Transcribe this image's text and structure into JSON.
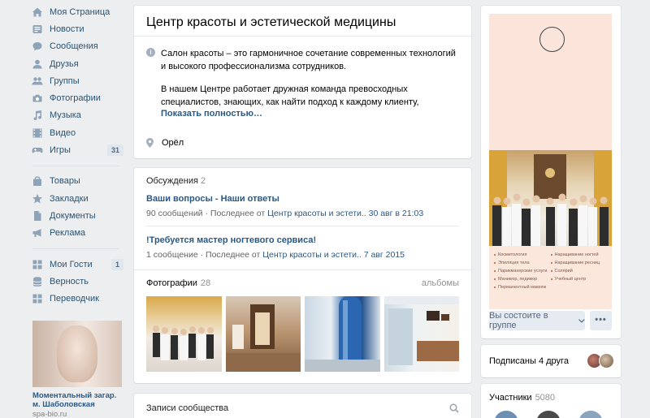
{
  "left_menu": {
    "items": [
      {
        "label": "Моя Страница",
        "icon": "home-icon"
      },
      {
        "label": "Новости",
        "icon": "news-icon"
      },
      {
        "label": "Сообщения",
        "icon": "messages-icon"
      },
      {
        "label": "Друзья",
        "icon": "friends-icon"
      },
      {
        "label": "Группы",
        "icon": "groups-icon"
      },
      {
        "label": "Фотографии",
        "icon": "camera-icon"
      },
      {
        "label": "Музыка",
        "icon": "music-icon"
      },
      {
        "label": "Видео",
        "icon": "video-icon"
      },
      {
        "label": "Игры",
        "icon": "gamepad-icon",
        "counter": "31"
      }
    ],
    "items2": [
      {
        "label": "Товары",
        "icon": "bag-icon"
      },
      {
        "label": "Закладки",
        "icon": "star-icon"
      },
      {
        "label": "Документы",
        "icon": "document-icon"
      },
      {
        "label": "Реклама",
        "icon": "megaphone-icon"
      }
    ],
    "items3": [
      {
        "label": "Мои Гости",
        "icon": "apps-icon",
        "counter": "1"
      },
      {
        "label": "Верность",
        "icon": "database-icon"
      },
      {
        "label": "Переводчик",
        "icon": "apps-icon"
      }
    ]
  },
  "ad": {
    "title": "Моментальный загар. м. Шаболовская",
    "domain": "spa-bio.ru"
  },
  "group": {
    "title": "Центр красоты и эстетической медицины",
    "description_line1": "Салон красоты             – это гармоничное сочетание современных технологий и высокого профессионализма сотрудников.",
    "description_line2": "В нашем Центре работает дружная команда превосходных специалистов, знающих, как найти подход к каждому клиенту,",
    "show_more": "Показать полностью…",
    "location": "Орёл"
  },
  "discussions": {
    "title": "Обсуждения",
    "count": "2",
    "topics": [
      {
        "title": "Ваши вопросы - Наши ответы",
        "count": "90 сообщений",
        "last_prefix": " · Последнее от ",
        "author": "Центр красоты и эстети..",
        "date": " 30 авг в 21:03"
      },
      {
        "title": "!Требуется мастер ногтевого сервиса!",
        "count": "1 сообщение",
        "last_prefix": " · Последнее от ",
        "author": "Центр красоты и эстети..",
        "date": " 7 авг 2015"
      }
    ]
  },
  "photos": {
    "title": "Фотографии",
    "count": "28",
    "albums_link": "альбомы"
  },
  "posts": {
    "title": "Записи сообщества"
  },
  "cover": {
    "services_left": [
      "Косметология",
      "Эпиляция тела",
      "Парикмахерские услуги",
      "Маникюр, педикюр",
      "Перманентный макияж"
    ],
    "services_right": [
      "Наращивание ногтей",
      "Наращивание ресниц",
      "Солярий",
      "Учебный центр"
    ]
  },
  "actions": {
    "member_button": "Вы состоите в группе",
    "more_button": "•••"
  },
  "friends": {
    "label": "Подписаны 4 друга"
  },
  "members": {
    "title": "Участники",
    "count": "5080"
  },
  "colors": {
    "link": "#2a5885",
    "menu_text": "#285473",
    "background": "#edeef0",
    "button_bg": "#e5ebf1"
  }
}
